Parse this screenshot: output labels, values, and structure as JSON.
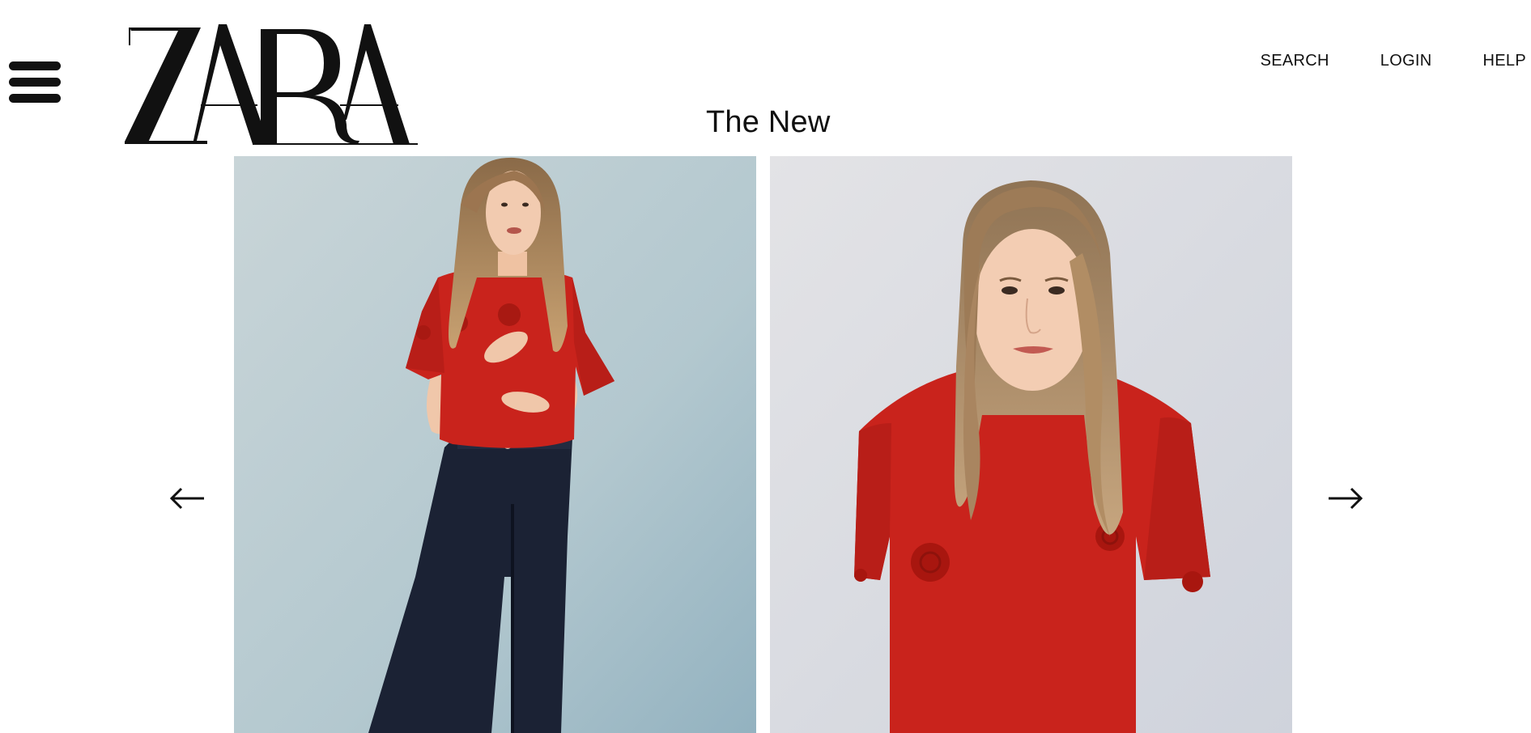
{
  "brand": {
    "logo_text": "ZARA"
  },
  "header": {
    "menu_icon": "hamburger-menu-icon",
    "nav": [
      {
        "label": "SEARCH"
      },
      {
        "label": "LOGIN"
      },
      {
        "label": "HELP"
      }
    ]
  },
  "section": {
    "title": "The New"
  },
  "carousel": {
    "prev_icon": "arrow-left-icon",
    "next_icon": "arrow-right-icon",
    "slides": [
      {
        "description": "girl in red top and dark wide jeans"
      },
      {
        "description": "girl in red t-shirt with rose appliqués"
      }
    ]
  },
  "colors": {
    "text": "#111111",
    "background": "#ffffff",
    "top_red": "#c9231c",
    "denim": "#1a2134",
    "backdrop_left": "#b8cbd1",
    "backdrop_right": "#dfe0e3"
  }
}
